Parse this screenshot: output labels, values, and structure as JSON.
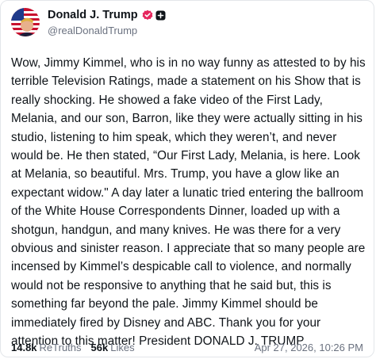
{
  "author": {
    "display_name": "Donald J. Trump",
    "handle": "@realDonaldTrump"
  },
  "post": {
    "text": "Wow, Jimmy Kimmel, who is in no way funny as attested to by his terrible Television Ratings, made a statement on his Show that is really shocking. He showed a fake video of the First Lady, Melania, and our son, Barron, like they were actually sitting in his studio, listening to him speak, which they weren’t, and never would be. He then stated, “Our First Lady, Melania, is here. Look at Melania, so beautiful. Mrs. Trump, you have a glow like an expectant widow.\" A day later a lunatic tried entering the ballroom of the White House Correspondents Dinner, loaded up with a shotgun, handgun, and many knives. He was there for a very obvious and sinister reason. I appreciate that so many people are incensed by Kimmel’s despicable call to violence, and normally would not be responsive to anything that he said but, this is something far beyond the pale. Jimmy Kimmel should be immediately fired by Disney and ABC. Thank you for your attention to this matter! President DONALD J. TRUMP"
  },
  "stats": {
    "retruths_count": "14.8k",
    "retruths_label": "ReTruths",
    "likes_count": "56k",
    "likes_label": "Likes"
  },
  "timestamp": "Apr 27, 2026, 10:26 PM",
  "icons": {
    "verified": "verified-badge-icon",
    "account_type": "square-plus-icon"
  },
  "colors": {
    "verified_badge": "#e5265d",
    "muted_text": "#6b7280"
  }
}
